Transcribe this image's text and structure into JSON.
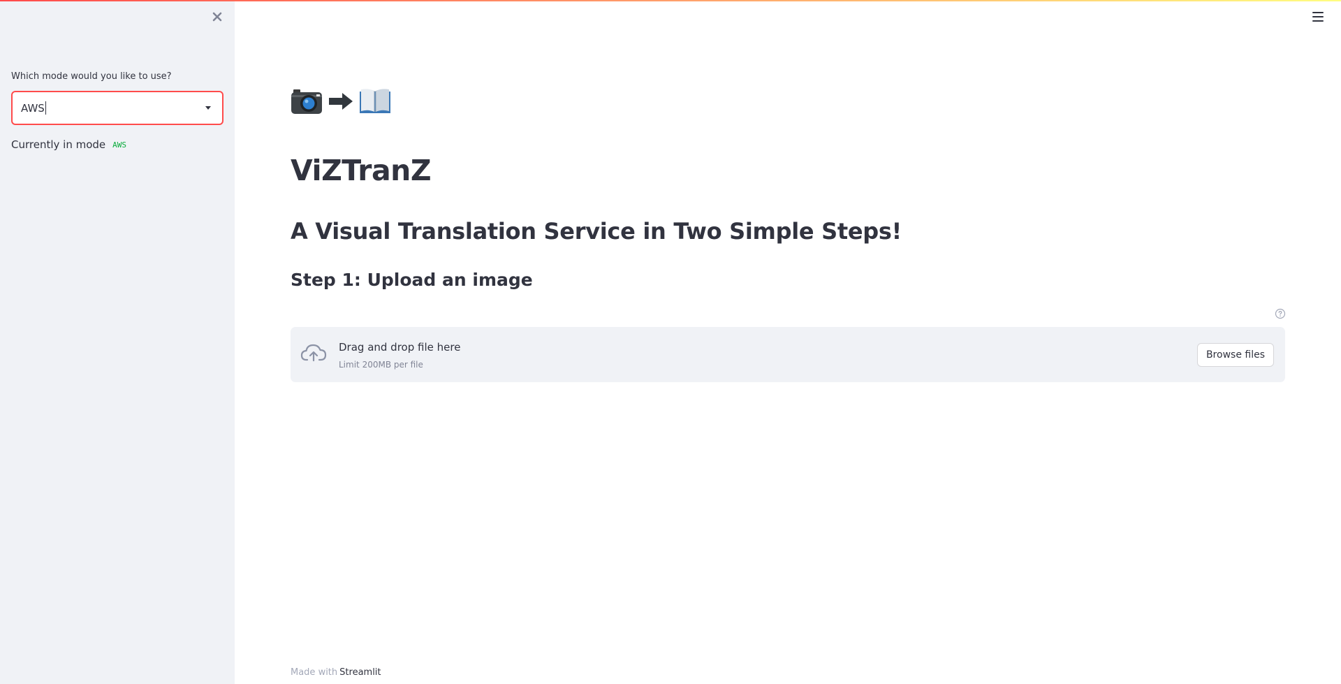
{
  "sidebar": {
    "mode_label": "Which mode would you like to use?",
    "mode_selected": "AWS",
    "current_mode_prefix": "Currently in mode",
    "current_mode_value": "AWS"
  },
  "main": {
    "title": "ViZTranZ",
    "subtitle": "A Visual Translation Service in Two Simple Steps!",
    "step1_heading": "Step 1: Upload an image",
    "emoji_icons": [
      "camera-icon",
      "right-arrow-icon",
      "open-book-icon"
    ]
  },
  "uploader": {
    "drop_text": "Drag and drop file here",
    "limit_text": "Limit 200MB per file",
    "browse_label": "Browse files"
  },
  "footer": {
    "prefix": "Made with",
    "link_text": "Streamlit"
  },
  "colors": {
    "accent": "#ff4b4b",
    "sidebar_bg": "#f0f2f6",
    "text": "#31333f",
    "code_green": "#09ab3b"
  }
}
